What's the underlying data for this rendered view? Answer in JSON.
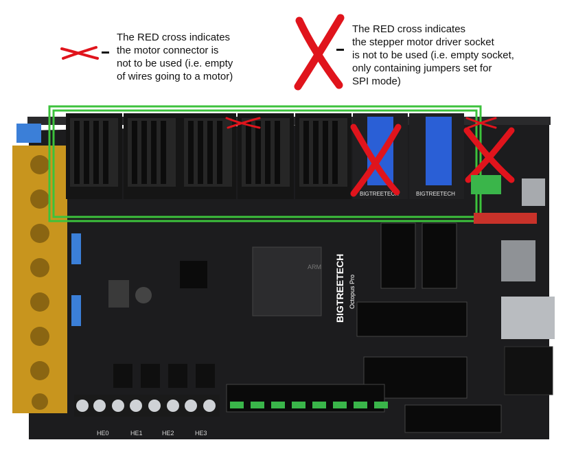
{
  "legend": {
    "small_cross_note": [
      "The RED cross indicates",
      "the motor connector is",
      "not to be used (i.e. empty",
      "of wires going to a motor)"
    ],
    "big_cross_note": [
      "The RED cross indicates",
      "the stepper motor driver socket",
      "is not to be used (i.e. empty socket,",
      "only containing jumpers set for",
      "SPI mode)"
    ]
  },
  "board": {
    "brand": "BIGTREETECH",
    "model": "Octopus Pro",
    "chip_label": "ARM",
    "heater_labels": [
      "HE0",
      "HE1",
      "HE2",
      "HE3"
    ],
    "driver_labels": [
      "BIGTREETECH",
      "BIGTREETECH"
    ]
  },
  "colors": {
    "cross_red": "#e0141c",
    "highlight_green": "#3cc23c",
    "pcb": "#1c1c1e",
    "terminal": "#c8951e",
    "jumper_blue": "#2a5fd6",
    "driver_sink": "#151515"
  },
  "slots": {
    "driver_sockets": 8,
    "populated_driver_sockets": 6,
    "unused_driver_sockets": [
      6
    ],
    "unused_motor_connectors": [
      4,
      8
    ]
  }
}
